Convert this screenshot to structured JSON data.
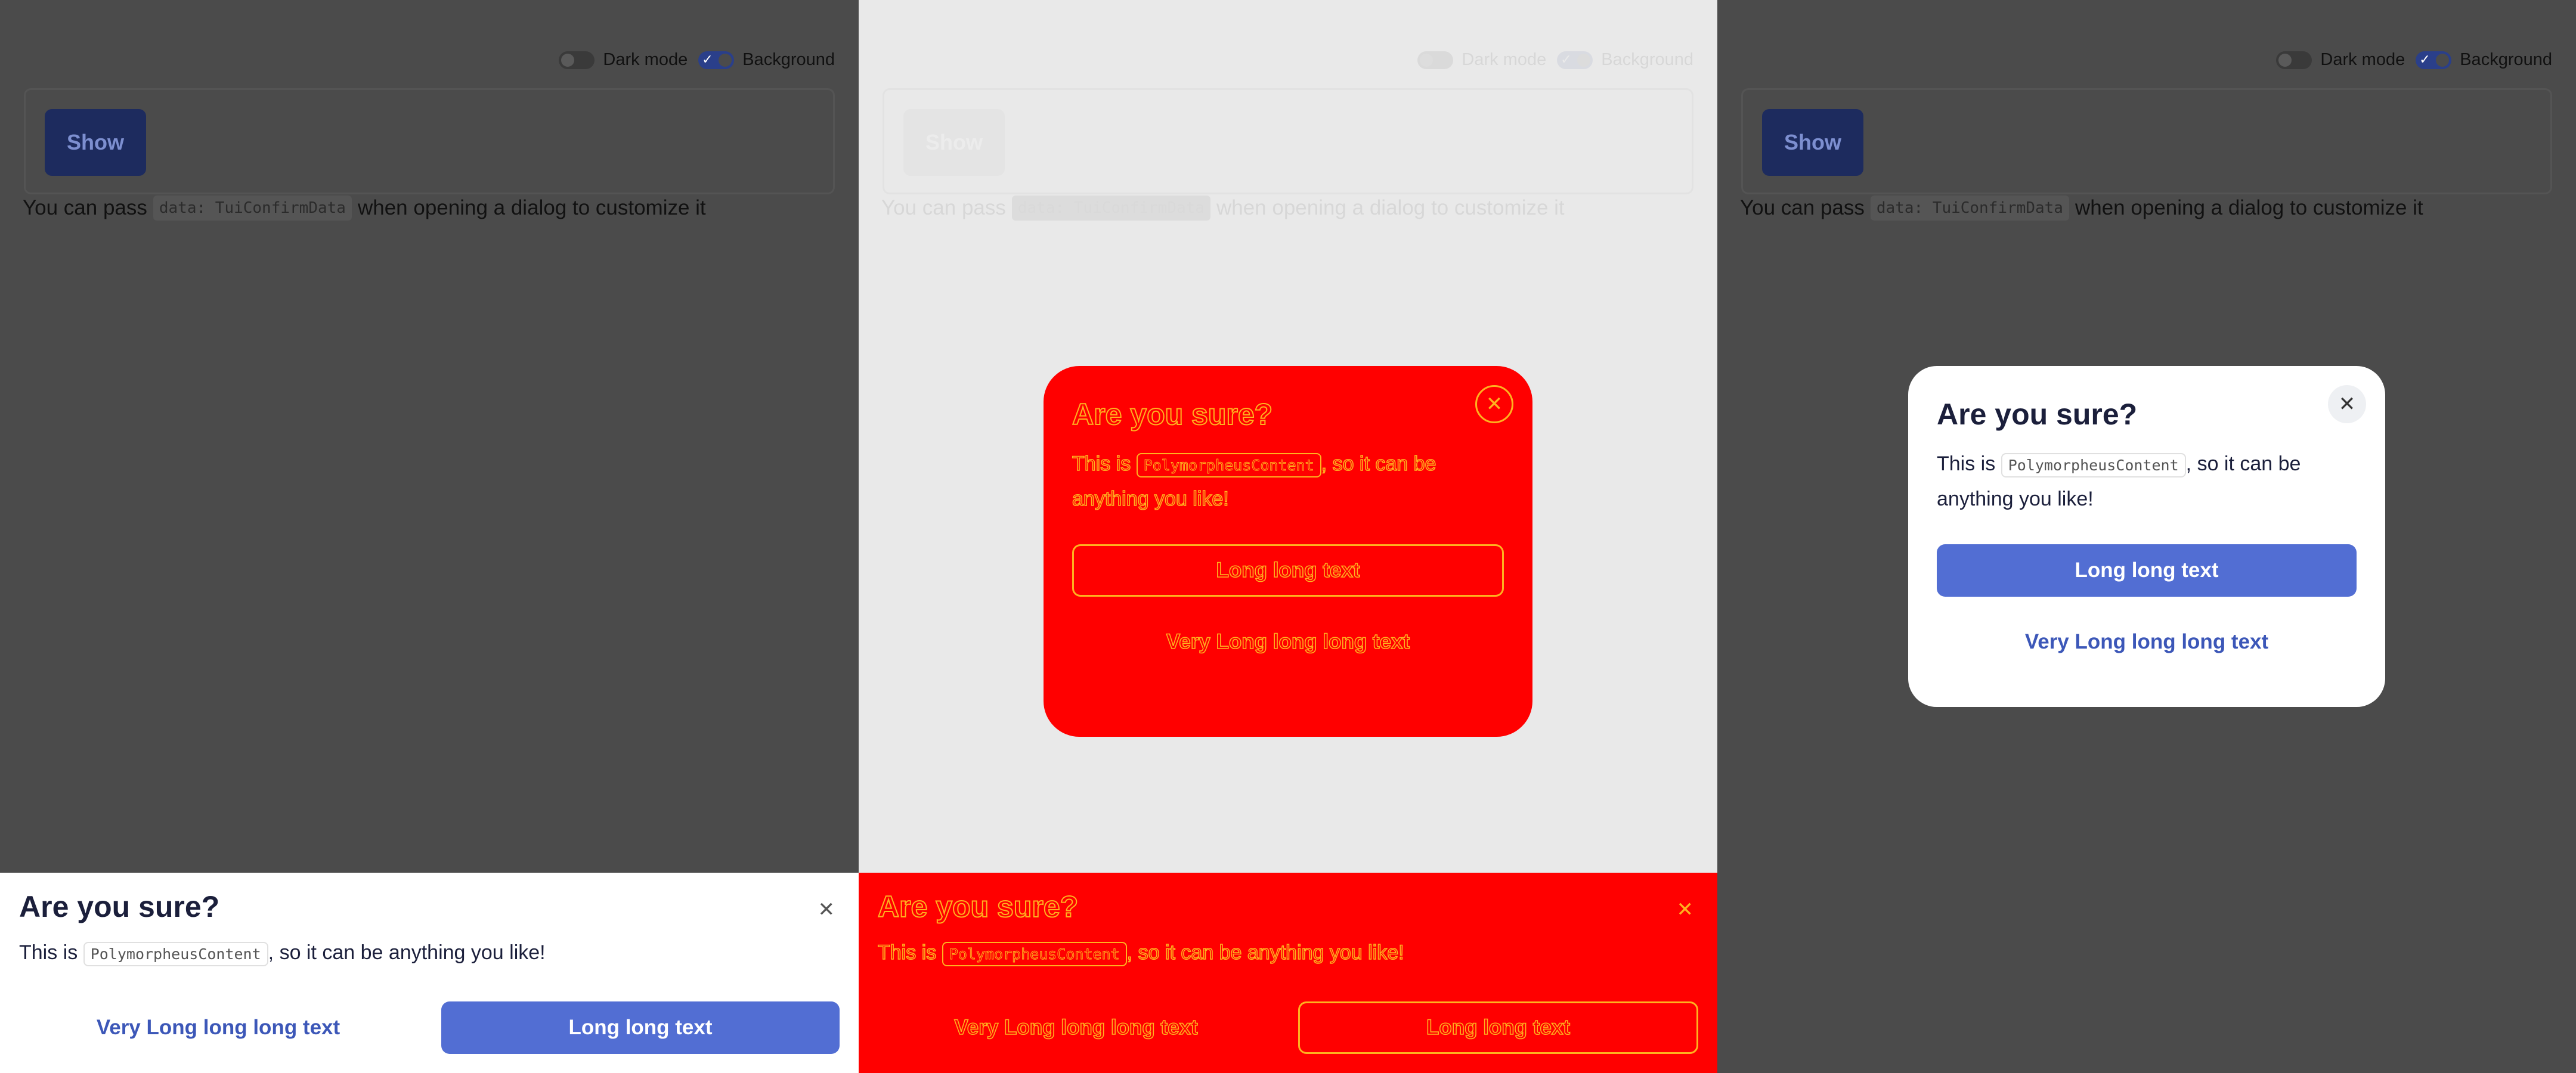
{
  "toolbar": {
    "dark_mode_label": "Dark mode",
    "background_label": "Background"
  },
  "demo": {
    "show_label": "Show",
    "desc_before": "You can pass",
    "desc_code": "data: TuiConfirmData",
    "desc_after": "when opening a dialog to customize it"
  },
  "dialog": {
    "title": "Are you sure?",
    "close_glyph": "✕",
    "text_before": "This is",
    "text_code": "PolymorpheusContent",
    "text_after": ", so it can be anything you like!",
    "primary_label": "Long long text",
    "secondary_label": "Very Long long long text"
  },
  "colors": {
    "primary": "#526ed3",
    "link": "#3c57b8",
    "highlight_red": "#ff0000",
    "highlight_outline": "#ffb21f"
  }
}
